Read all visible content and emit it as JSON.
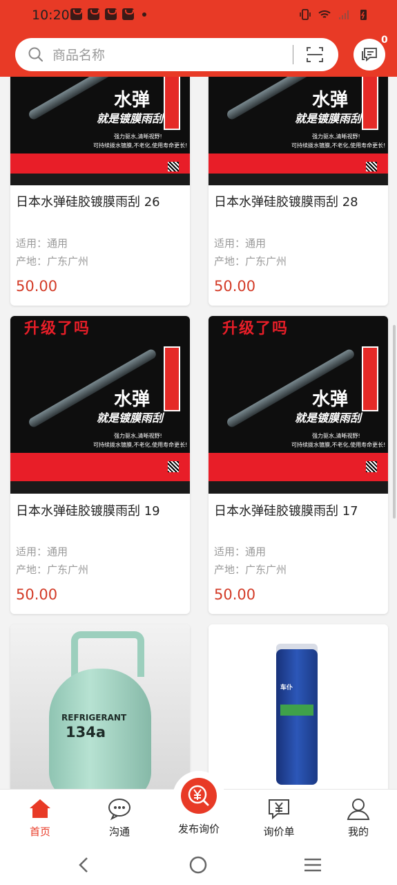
{
  "status_bar": {
    "time": "10:20"
  },
  "search": {
    "placeholder": "商品名称"
  },
  "messages": {
    "badge_count": "0"
  },
  "products": [
    {
      "name": "日本水弹硅胶镀膜雨刮 26",
      "applicable": "适用：通用",
      "origin": "产地：广东广州",
      "price": "50.00"
    },
    {
      "name": "日本水弹硅胶镀膜雨刮 28",
      "applicable": "适用：通用",
      "origin": "产地：广东广州",
      "price": "50.00"
    },
    {
      "name": "日本水弹硅胶镀膜雨刮 19",
      "applicable": "适用：通用",
      "origin": "产地：广东广州",
      "price": "50.00"
    },
    {
      "name": "日本水弹硅胶镀膜雨刮 17",
      "applicable": "适用：通用",
      "origin": "产地：广东广州",
      "price": "50.00"
    }
  ],
  "image_text": {
    "wiper_main": "水弹",
    "wiper_slogan": "就是镀膜雨刮",
    "wiper_line1": "强力驱水,清晰视野!",
    "wiper_line2": "可持续拨水镀膜,不老化,使用寿命更长!",
    "wiper_headline": "升级了吗",
    "tank_brand": "REFRIGERANT",
    "tank_model": "134a",
    "can_brand": "车仆"
  },
  "bottom_nav": {
    "home": "首页",
    "chat": "沟通",
    "publish": "发布询价",
    "inquiry": "询价单",
    "mine": "我的"
  },
  "colors": {
    "brand": "#e83a26",
    "price": "#d33a26"
  }
}
